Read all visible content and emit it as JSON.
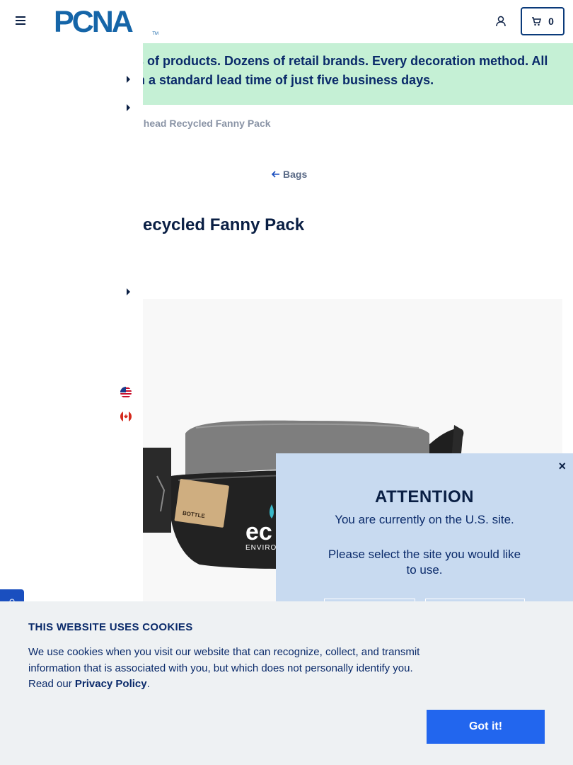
{
  "header": {
    "logo_text": "PCNA",
    "logo_tm": "TM",
    "cart_count": "0"
  },
  "banner": {
    "line1": "ls of products. Dozens of retail brands. Every decoration method. All",
    "line2": "th a standard lead time of just five business days."
  },
  "breadcrumb": {
    "current": "ilhead Recycled Fanny Pack"
  },
  "back_link": {
    "label": "Bags"
  },
  "product": {
    "title": "ecycled Fanny Pack",
    "image_brand_text": "ec",
    "image_brand_sub": "ENVIRON",
    "tag_text": "BOTTLE"
  },
  "attention": {
    "title": "ATTENTION",
    "message": "You are currently on the U.S. site.",
    "prompt": "Please select the site you would like to use.",
    "close_label": "×"
  },
  "cookie": {
    "title": "THIS WEBSITE USES COOKIES",
    "body": "We use cookies when you visit our website that can recognize, collect, and transmit information that is associated with you, but which does not personally identify you. Read our ",
    "link": "Privacy Policy",
    "suffix": ".",
    "button": "Got it!"
  },
  "colors": {
    "navy": "#0a1f44",
    "banner_bg": "#c5f0d5",
    "modal_bg": "#c8daf0",
    "cookie_bg": "#eef1f3",
    "accent_blue": "#2266ee",
    "logo_blue": "#1565a8"
  }
}
